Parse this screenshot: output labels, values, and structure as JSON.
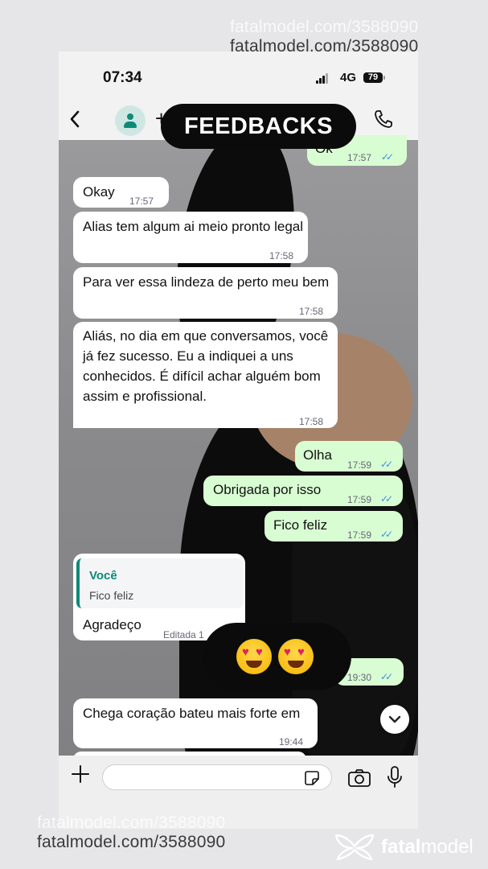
{
  "watermarks": {
    "top_1": "fatalmodel.com/3588090",
    "top_2": "fatalmodel.com/3588090",
    "bottom_1": "fatalmodel.com/3588090",
    "bottom_2": "fatalmodel.com/3588090"
  },
  "status_bar": {
    "time": "07:34",
    "network": "4G",
    "battery": "79"
  },
  "header": {
    "back_icon": "chevron-left-icon",
    "avatar_icon": "person-icon",
    "partial_plus": "+",
    "call_icon": "phone-icon"
  },
  "overlay_title": "FEEDBACKS",
  "messages": [
    {
      "dir": "out",
      "text": "Ok",
      "time": "17:57",
      "read": true
    },
    {
      "dir": "in",
      "text": "Okay",
      "time": "17:57"
    },
    {
      "dir": "in",
      "text": "Alias tem algum ai meio pronto legal",
      "time": "17:58"
    },
    {
      "dir": "in",
      "text": "Para ver essa lindeza de perto meu bem",
      "time": "17:58"
    },
    {
      "dir": "in",
      "text": "Aliás, no dia em que conversamos, você já fez sucesso. Eu a indiquei a uns conhecidos. É difícil achar alguém bom assim e profissional.",
      "time": "17:58"
    },
    {
      "dir": "out",
      "text": "Olha",
      "time": "17:59",
      "read": true
    },
    {
      "dir": "out",
      "text": "Obrigada por isso",
      "time": "17:59",
      "read": true
    },
    {
      "dir": "out",
      "text": "Fico feliz",
      "time": "17:59",
      "read": true
    },
    {
      "dir": "in",
      "reply_author": "Você",
      "reply_text": "Fico feliz",
      "text": "Agradeço",
      "edited_label": "Editada 1"
    },
    {
      "dir": "out",
      "emoji": "heart-eyes-emoji",
      "time": "19:30",
      "read": true
    },
    {
      "dir": "in",
      "text": "Chega coração bateu mais forte em",
      "time": "19:44"
    }
  ],
  "input_bar": {
    "plus_icon": "plus-icon",
    "placeholder": "",
    "sticker_icon": "sticker-icon",
    "camera_icon": "camera-icon",
    "mic_icon": "microphone-icon"
  },
  "brand": {
    "logo_icon": "fatalmodel-logo-icon",
    "name_bold": "fatal",
    "name_regular": "model"
  },
  "colors": {
    "outgoing_bubble": "#d9fdd3",
    "incoming_bubble": "#ffffff",
    "accent_green": "#0d8a76",
    "read_ticks": "#3b8fde"
  }
}
